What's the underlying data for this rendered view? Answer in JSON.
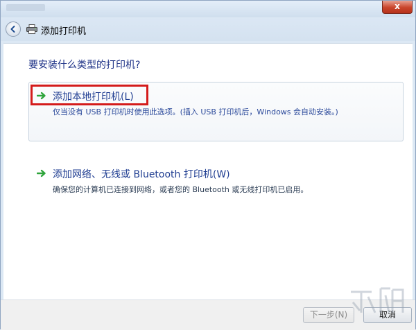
{
  "window": {
    "title": "添加打印机",
    "close_label": "x"
  },
  "main": {
    "question": "要安装什么类型的打印机?",
    "options": [
      {
        "title": "添加本地打印机(L)",
        "description": "仅当没有 USB 打印机时使用此选项。(插入 USB 打印机后，Windows 会自动安装。)"
      },
      {
        "title": "添加网络、无线或 Bluetooth 打印机(W)",
        "description": "确保您的计算机已连接到网络，或者您的 Bluetooth 或无线打印机已启用。"
      }
    ]
  },
  "footer": {
    "next_label": "下一步(N)",
    "cancel_label": "取消"
  },
  "icons": {
    "back": "back-arrow-icon",
    "printer": "printer-icon",
    "option_arrow": "green-arrow-icon"
  },
  "colors": {
    "accent_text": "#1f3d91",
    "highlight": "#d41b1b",
    "arrow": "#2ea43a"
  }
}
